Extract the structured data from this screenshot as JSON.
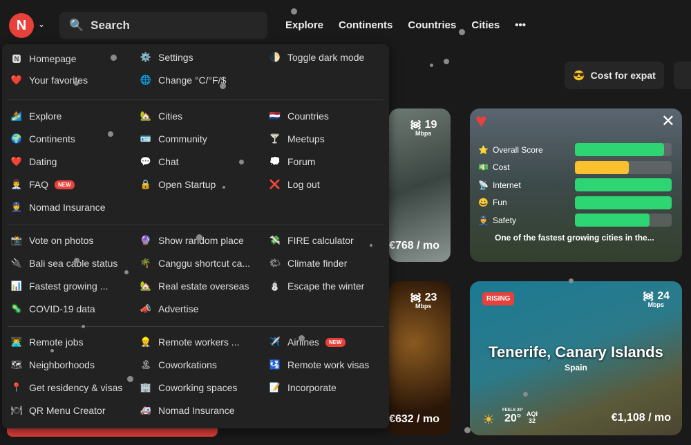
{
  "header": {
    "search_placeholder": "Search",
    "nav": [
      "Explore",
      "Continents",
      "Countries",
      "Cities"
    ],
    "more": "•••",
    "filter": "Cost for expat",
    "filter_icon": "😎"
  },
  "menu": {
    "sections": [
      [
        {
          "icon": "🅽",
          "label": "Homepage"
        },
        {
          "icon": "⚙️",
          "label": "Settings"
        },
        {
          "icon": "🌓",
          "label": "Toggle dark mode"
        },
        {
          "icon": "❤️",
          "label": "Your favorites"
        },
        {
          "icon": "🌐",
          "label": "Change °C/°F/$"
        }
      ],
      [
        {
          "icon": "🏄",
          "label": "Explore"
        },
        {
          "icon": "🏡",
          "label": "Cities"
        },
        {
          "icon": "🇳🇱",
          "label": "Countries"
        },
        {
          "icon": "🌍",
          "label": "Continents"
        },
        {
          "icon": "🪪",
          "label": "Community"
        },
        {
          "icon": "🍸",
          "label": "Meetups"
        },
        {
          "icon": "❤️",
          "label": "Dating"
        },
        {
          "icon": "💬",
          "label": "Chat"
        },
        {
          "icon": "💭",
          "label": "Forum"
        },
        {
          "icon": "👨‍💼",
          "label": "FAQ",
          "badge": "NEW"
        },
        {
          "icon": "🔒",
          "label": "Open Startup"
        },
        {
          "icon": "❌",
          "label": "Log out"
        },
        {
          "icon": "👮",
          "label": "Nomad Insurance"
        }
      ],
      [
        {
          "icon": "📸",
          "label": "Vote on photos"
        },
        {
          "icon": "🔮",
          "label": "Show random place"
        },
        {
          "icon": "💸",
          "label": "FIRE calculator"
        },
        {
          "icon": "🔌",
          "label": "Bali sea cable status"
        },
        {
          "icon": "🌴",
          "label": "Canggu shortcut ca..."
        },
        {
          "icon": "🌤",
          "label": "Climate finder"
        },
        {
          "icon": "📊",
          "label": "Fastest growing ..."
        },
        {
          "icon": "🏡",
          "label": "Real estate overseas"
        },
        {
          "icon": "⛄",
          "label": "Escape the winter"
        },
        {
          "icon": "🦠",
          "label": "COVID-19 data"
        },
        {
          "icon": "📣",
          "label": "Advertise"
        }
      ],
      [
        {
          "icon": "👨‍💻",
          "label": "Remote jobs"
        },
        {
          "icon": "👷",
          "label": "Remote workers ..."
        },
        {
          "icon": "✈️",
          "label": "Airlines",
          "badge": "NEW"
        },
        {
          "icon": "🗺",
          "label": "Neighborhoods"
        },
        {
          "icon": "🏝",
          "label": "Coworkations"
        },
        {
          "icon": "🛂",
          "label": "Remote work visas"
        },
        {
          "icon": "📍",
          "label": "Get residency & visas"
        },
        {
          "icon": "🏢",
          "label": "Coworking spaces"
        },
        {
          "icon": "📝",
          "label": "Incorporate"
        },
        {
          "icon": "🍽",
          "label": "QR Menu Creator"
        },
        {
          "icon": "🚑",
          "label": "Nomad Insurance"
        }
      ]
    ]
  },
  "cards": {
    "c1": {
      "mbps": "19",
      "unit": "Mbps",
      "price": "€768 / mo"
    },
    "c2": {
      "scores": [
        {
          "icon": "⭐",
          "label": "Overall Score",
          "value": 0.92,
          "color": "#2ed573"
        },
        {
          "icon": "💵",
          "label": "Cost",
          "value": 0.56,
          "color": "#fbc02d"
        },
        {
          "icon": "📡",
          "label": "Internet",
          "value": 1.0,
          "color": "#2ed573"
        },
        {
          "icon": "😀",
          "label": "Fun",
          "value": 1.0,
          "color": "#2ed573"
        },
        {
          "icon": "👮",
          "label": "Safety",
          "value": 0.77,
          "color": "#2ed573"
        }
      ],
      "description": "One of the fastest growing cities in the..."
    },
    "c3": {
      "mbps": "23",
      "unit": "Mbps",
      "price": "€632 / mo"
    },
    "c4": {
      "badge": "RISING",
      "mbps": "24",
      "unit": "Mbps",
      "city": "Tenerife, Canary Islands",
      "country": "Spain",
      "feels": "FEELS 20°",
      "temp": "20°",
      "aqi_label": "AQI",
      "aqi": "32",
      "price": "€1,108 / mo"
    }
  }
}
